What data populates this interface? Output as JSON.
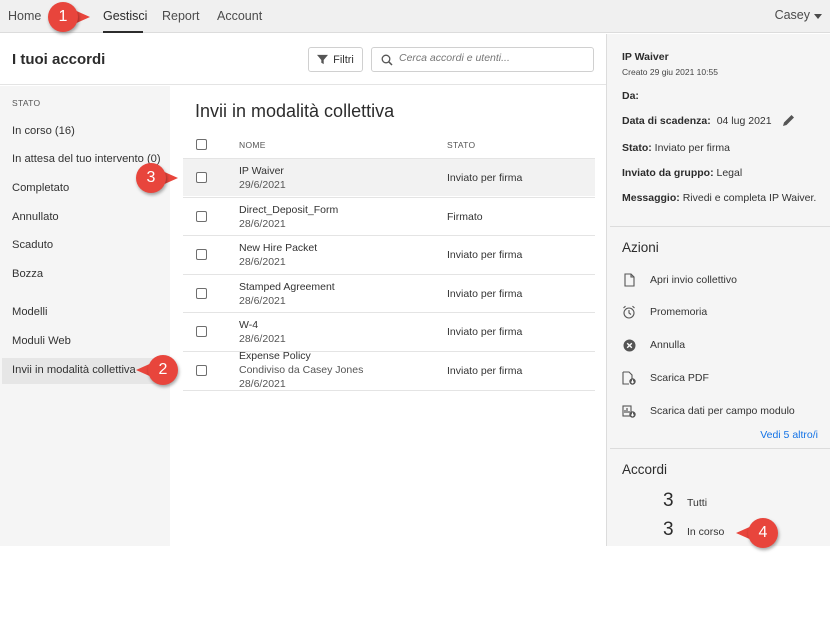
{
  "nav": {
    "items": [
      "Home",
      "Gestisci",
      "Report",
      "Account"
    ],
    "active": "Gestisci",
    "user": "Casey"
  },
  "header": {
    "title": "I tuoi accordi",
    "filter_label": "Filtri",
    "search_placeholder": "Cerca accordi e utenti..."
  },
  "sidebar": {
    "heading": "STATO",
    "status_items": [
      "In corso (16)",
      "In attesa del tuo intervento (0)",
      "Completato",
      "Annullato",
      "Scaduto",
      "Bozza"
    ],
    "other_items": [
      "Modelli",
      "Moduli Web",
      "Invii in modalità collettiva"
    ],
    "selected": "Invii in modalità collettiva"
  },
  "main": {
    "title": "Invii in modalità collettiva",
    "columns": {
      "name": "NOME",
      "status": "STATO"
    },
    "rows": [
      {
        "name": "IP Waiver",
        "sub": "",
        "date": "29/6/2021",
        "status": "Inviato per firma",
        "hover": true
      },
      {
        "name": "Direct_Deposit_Form",
        "sub": "",
        "date": "28/6/2021",
        "status": "Firmato",
        "hover": false
      },
      {
        "name": "New Hire Packet",
        "sub": "",
        "date": "28/6/2021",
        "status": "Inviato per firma",
        "hover": false
      },
      {
        "name": "Stamped Agreement",
        "sub": "",
        "date": "28/6/2021",
        "status": "Inviato per firma",
        "hover": false
      },
      {
        "name": "W-4",
        "sub": "",
        "date": "28/6/2021",
        "status": "Inviato per firma",
        "hover": false
      },
      {
        "name": "Expense Policy",
        "sub": "Condiviso da Casey Jones",
        "date": "28/6/2021",
        "status": "Inviato per firma",
        "hover": false
      }
    ]
  },
  "details": {
    "title": "IP Waiver",
    "created": "Creato 29 giu 2021 10:55",
    "da_label": "Da:",
    "due_label": "Data di scadenza:",
    "due_value": "04 lug 2021",
    "state_label": "Stato:",
    "state_value": "Inviato per firma",
    "group_label": "Inviato da gruppo:",
    "group_value": "Legal",
    "message_label": "Messaggio:",
    "message_value": "Rivedi e completa IP Waiver.",
    "actions_title": "Azioni",
    "actions": [
      {
        "label": "Apri invio collettivo",
        "icon": "document-icon"
      },
      {
        "label": "Promemoria",
        "icon": "alarm-clock-icon"
      },
      {
        "label": "Annulla",
        "icon": "cancel-circle-icon"
      },
      {
        "label": "Scarica PDF",
        "icon": "download-pdf-icon"
      },
      {
        "label": "Scarica dati per campo modulo",
        "icon": "download-data-icon"
      }
    ],
    "more_link": "Vedi 5 altro/i",
    "agreements_title": "Accordi",
    "agreements": [
      {
        "count": "3",
        "label": "Tutti"
      },
      {
        "count": "3",
        "label": "In corso"
      }
    ]
  },
  "callouts": [
    "1",
    "2",
    "3",
    "4"
  ],
  "colors": {
    "callout": "#e8453c",
    "link": "#1473e6",
    "sidebar_bg": "#f5f5f5",
    "nav_bg": "#f0f0f0"
  }
}
